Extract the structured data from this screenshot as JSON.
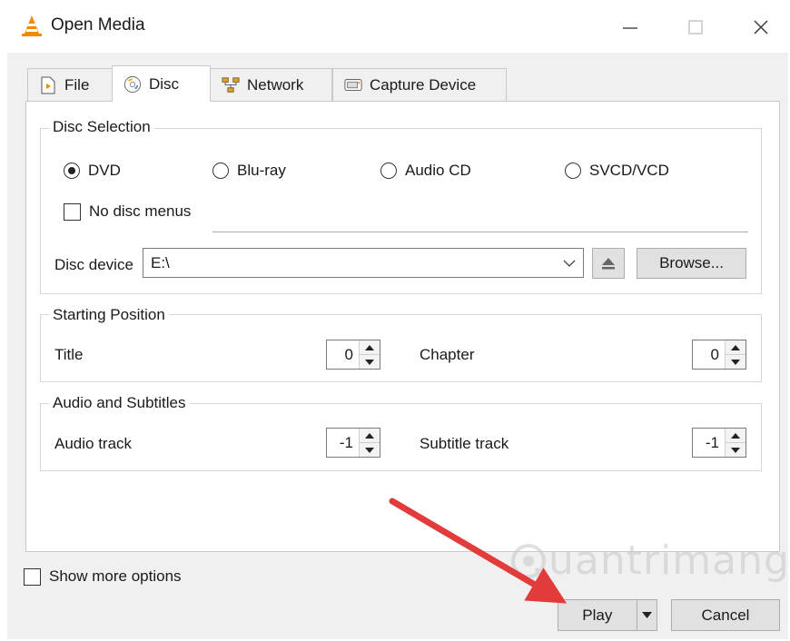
{
  "window": {
    "title": "Open Media",
    "controls": {
      "minimize": "—",
      "maximize": "☐",
      "close": "✕"
    }
  },
  "tabs": [
    {
      "label": "File",
      "icon": "file-icon",
      "active": false
    },
    {
      "label": "Disc",
      "icon": "disc-icon",
      "active": true
    },
    {
      "label": "Network",
      "icon": "network-icon",
      "active": false
    },
    {
      "label": "Capture Device",
      "icon": "capture-device-icon",
      "active": false
    }
  ],
  "disc_selection": {
    "legend": "Disc Selection",
    "options": [
      {
        "label": "DVD",
        "selected": true
      },
      {
        "label": "Blu-ray",
        "selected": false
      },
      {
        "label": "Audio CD",
        "selected": false
      },
      {
        "label": "SVCD/VCD",
        "selected": false
      }
    ],
    "no_disc_menus": {
      "label": "No disc menus",
      "checked": false
    },
    "disc_device_label": "Disc device",
    "disc_device_value": "E:\\",
    "browse_label": "Browse..."
  },
  "starting_position": {
    "legend": "Starting Position",
    "title_label": "Title",
    "title_value": "0",
    "chapter_label": "Chapter",
    "chapter_value": "0"
  },
  "audio_subtitles": {
    "legend": "Audio and Subtitles",
    "audio_label": "Audio track",
    "audio_value": "-1",
    "subtitle_label": "Subtitle track",
    "subtitle_value": "-1"
  },
  "show_more_options": {
    "label": "Show more options",
    "checked": false
  },
  "buttons": {
    "play": "Play",
    "cancel": "Cancel"
  },
  "watermark": "uantrimang",
  "colors": {
    "accent_arrow": "#e23b3b",
    "vlc_orange": "#f08a00"
  }
}
